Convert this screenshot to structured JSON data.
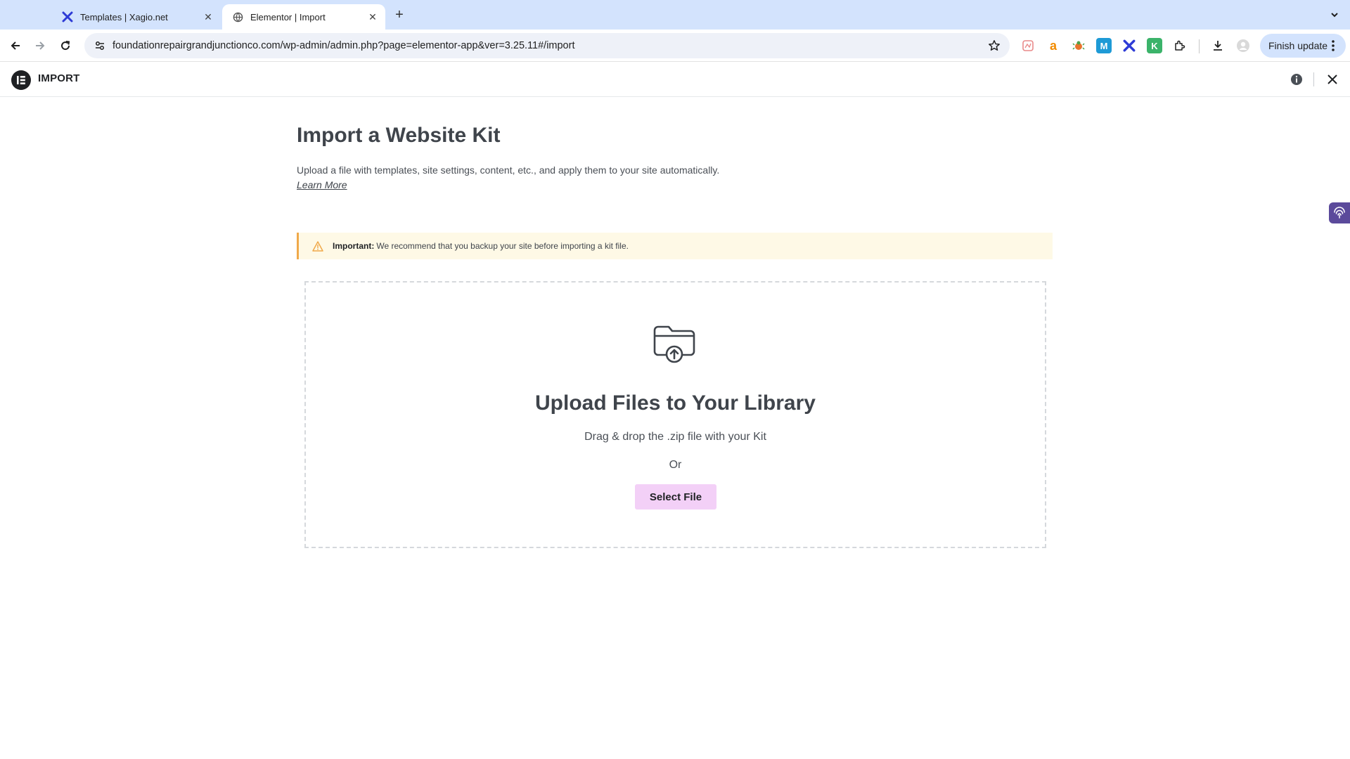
{
  "browser": {
    "tabs": [
      {
        "title": "Templates | Xagio.net",
        "active": false,
        "icon": "xagio-icon"
      },
      {
        "title": "Elementor | Import",
        "active": true,
        "icon": "globe-icon"
      }
    ],
    "url": "foundationrepairgrandjunctionco.com/wp-admin/admin.php?page=elementor-app&ver=3.25.11#/import",
    "update_button": "Finish update",
    "extension_letters": {
      "amazon": "a",
      "k": "K",
      "m": "M"
    }
  },
  "app": {
    "title": "IMPORT"
  },
  "main": {
    "heading": "Import a Website Kit",
    "description": "Upload a file with templates, site settings, content, etc., and apply them to your site automatically.",
    "learn_more": "Learn More",
    "notice": {
      "label": "Important:",
      "text": "We recommend that you backup your site before importing a kit file."
    },
    "dropzone": {
      "title": "Upload Files to Your Library",
      "subtitle": "Drag & drop the .zip file with your Kit",
      "or": "Or",
      "button": "Select File"
    }
  },
  "colors": {
    "tabstrip": "#d3e3fd",
    "button_accent": "#f3d0f7",
    "notice_bg": "#fef9e6",
    "notice_border": "#f0a94a",
    "heading": "#3f444b"
  }
}
